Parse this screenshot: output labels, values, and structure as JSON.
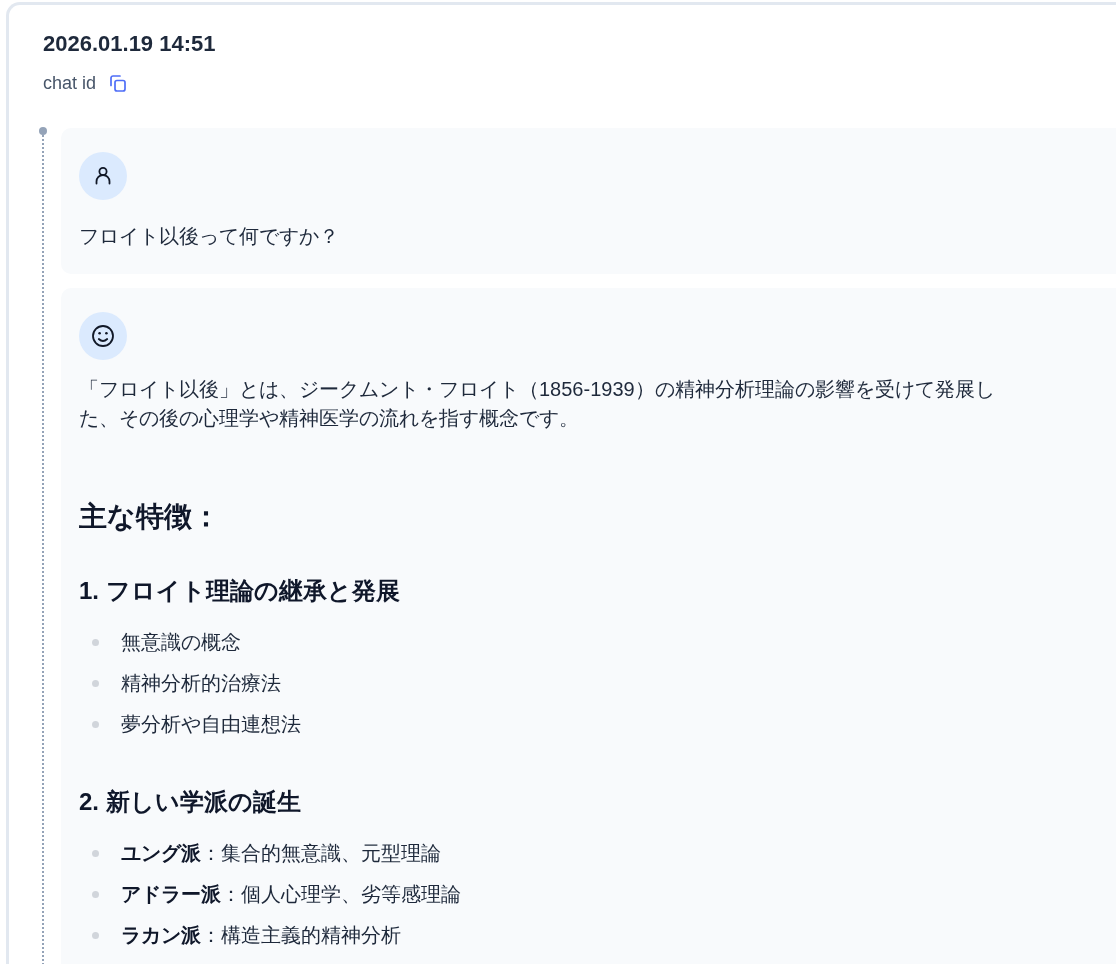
{
  "header": {
    "timestamp": "2026.01.19 14:51",
    "chat_id_label": "chat id"
  },
  "messages": [
    {
      "kind": "user",
      "blocks": [
        {
          "kind": "paragraph",
          "text": "フロイト以後って何ですか？"
        }
      ]
    },
    {
      "kind": "assistant",
      "blocks": [
        {
          "kind": "paragraph",
          "text": "「フロイト以後」とは、ジークムント・フロイト（1856-1939）の精神分析理論の影響を受けて発展した、その後の心理学や精神医学の流れを指す概念です。"
        },
        {
          "kind": "heading",
          "text": "主な特徴："
        },
        {
          "kind": "subheading",
          "text": "1. フロイト理論の継承と発展"
        },
        {
          "kind": "list",
          "items": [
            "無意識の概念",
            "精神分析的治療法",
            "夢分析や自由連想法"
          ]
        },
        {
          "kind": "subheading",
          "text": "2. 新しい学派の誕生"
        },
        {
          "kind": "list",
          "items": [
            "**ユング派**：集合的無意識、元型理論",
            "**アドラー派**：個人心理学、劣等感理論",
            "**ラカン派**：構造主義的精神分析"
          ]
        }
      ]
    }
  ]
}
